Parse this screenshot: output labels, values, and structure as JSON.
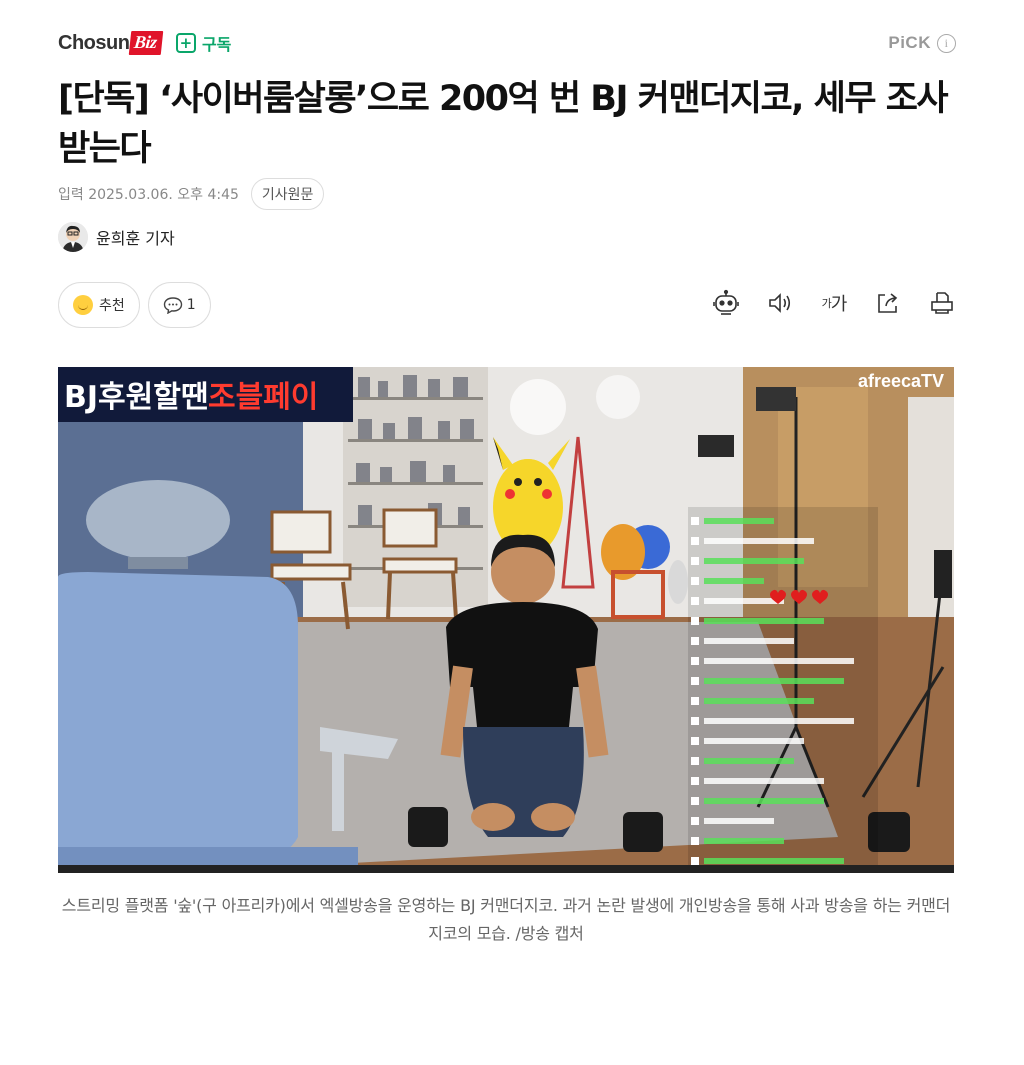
{
  "header": {
    "brand_main": "Chosun",
    "brand_accent": "Biz",
    "subscribe_label": "구독",
    "pick_label": "PiCK",
    "info_symbol": "i"
  },
  "article": {
    "title": "[단독] ‘사이버룸살롱’으로 200억 번 BJ 커맨더지코, 세무 조사 받는다",
    "published": "입력 2025.03.06. 오후 4:45",
    "original_link_label": "기사원문",
    "author": "윤희훈 기자"
  },
  "actions": {
    "recommend_label": "추천",
    "comment_count": "1"
  },
  "toolbar_icons": [
    "robot-summary-icon",
    "speaker-icon",
    "text-size-icon",
    "share-icon",
    "print-icon"
  ],
  "text_size_label_small": "가",
  "text_size_label_large": "가",
  "photo": {
    "overlay_prefix": "BJ후원할땐",
    "overlay_highlight": "조블페이",
    "watermark": "afreecaTV"
  },
  "caption": "스트리밍 플랫폼 '숲'(구 아프리카)에서 엑셀방송을 운영하는 BJ 커맨더지코. 과거 논란 발생에 개인방송을 통해 사과 방송을 하는 커맨더지코의 모습. /방송 캡처",
  "colors": {
    "brand_red": "#e0142a",
    "subscribe_green": "#0aa66a",
    "meta_gray": "#888888"
  }
}
